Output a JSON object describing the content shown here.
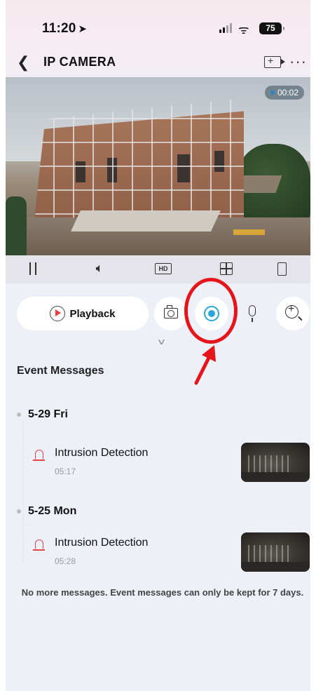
{
  "status_bar": {
    "time": "11:20",
    "battery": "75"
  },
  "header": {
    "title": "IP CAMERA"
  },
  "video": {
    "timer": "00:02"
  },
  "actions": {
    "playback_label": "Playback"
  },
  "events": {
    "section_title": "Event Messages",
    "groups": [
      {
        "date": "5-29 Fri",
        "items": [
          {
            "name": "Intrusion Detection",
            "time": "05:17"
          }
        ]
      },
      {
        "date": "5-25 Mon",
        "items": [
          {
            "name": "Intrusion Detection",
            "time": "05:28"
          }
        ]
      }
    ],
    "footer": "No more messages. Event messages can only be kept for 7 days."
  },
  "colors": {
    "accent": "#2aa7d6",
    "alert": "#e04646",
    "highlight": "#e5151b"
  }
}
